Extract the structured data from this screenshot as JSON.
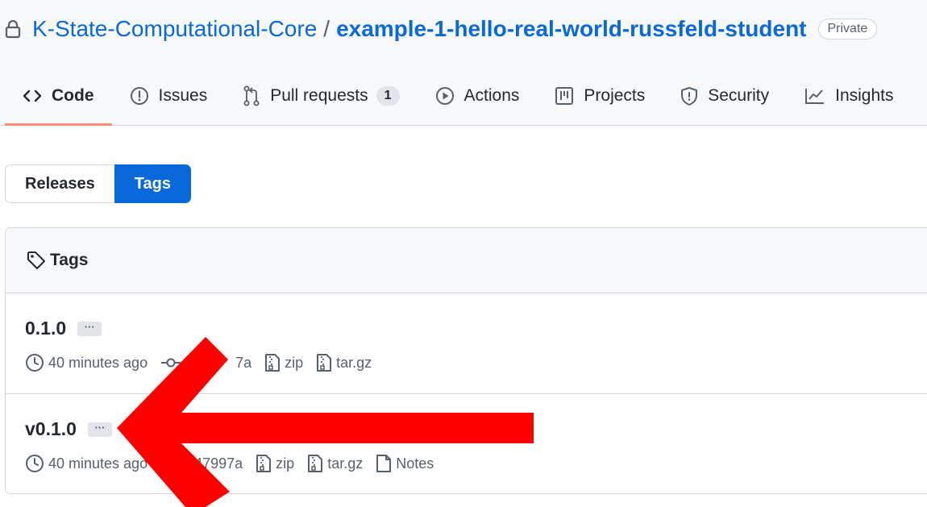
{
  "repo": {
    "owner": "K-State-Computational-Core",
    "separator": "/",
    "name": "example-1-hello-real-world-russfeld-student",
    "visibility": "Private"
  },
  "tabs": [
    {
      "label": "Code",
      "icon": "code-icon",
      "active": true
    },
    {
      "label": "Issues",
      "icon": "issue-icon"
    },
    {
      "label": "Pull requests",
      "icon": "pull-request-icon",
      "count": "1"
    },
    {
      "label": "Actions",
      "icon": "play-icon"
    },
    {
      "label": "Projects",
      "icon": "project-icon"
    },
    {
      "label": "Security",
      "icon": "shield-icon"
    },
    {
      "label": "Insights",
      "icon": "graph-icon"
    }
  ],
  "toggle": {
    "releases": "Releases",
    "tags": "Tags",
    "selected": "Tags"
  },
  "box": {
    "title": "Tags"
  },
  "tag_list": [
    {
      "name": "0.1.0",
      "more": "···",
      "time": "40 minutes ago",
      "commit": "7a",
      "zip": "zip",
      "tar": "tar.gz"
    },
    {
      "name": "v0.1.0",
      "more": "···",
      "time": "40 minutes ago",
      "commit": "47997a",
      "zip": "zip",
      "tar": "tar.gz",
      "notes": "Notes"
    }
  ],
  "annotation": {
    "color": "#ff0000",
    "shape": "arrow-left"
  },
  "colors": {
    "link": "#0969da",
    "active_tab_underline": "#fd8c73",
    "selected_button": "#0969da"
  }
}
